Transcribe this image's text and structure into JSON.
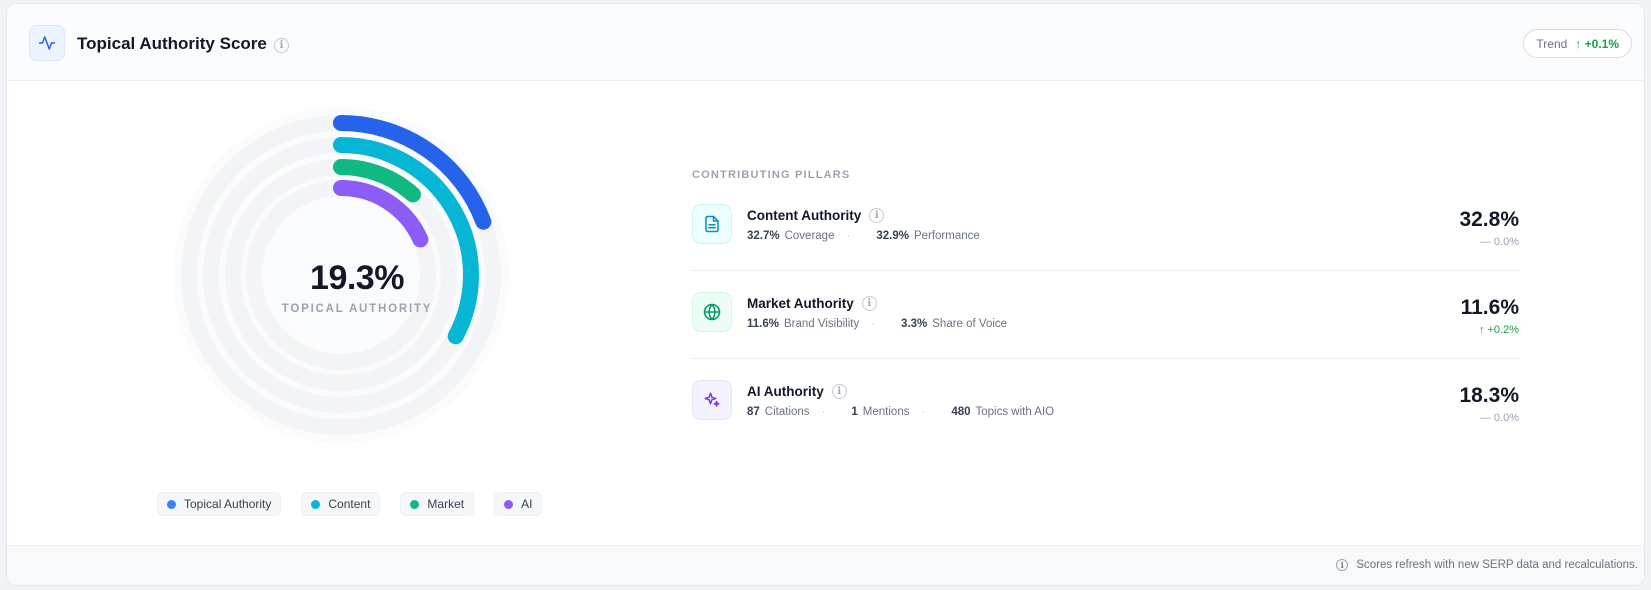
{
  "header": {
    "title": "Topical Authority Score",
    "icon": "activity-icon",
    "trend_label": "Trend",
    "trend_value": "+0.1%",
    "trend_arrow": "↑"
  },
  "chart": {
    "center_value": "19.3%",
    "center_label": "TOPICAL AUTHORITY"
  },
  "chart_data": {
    "type": "radial-bar",
    "series": [
      {
        "name": "Topical Authority",
        "value": 19.3,
        "color": "#2563eb"
      },
      {
        "name": "Content",
        "value": 32.8,
        "color": "#06b6d4"
      },
      {
        "name": "Market",
        "value": 11.6,
        "color": "#10b981"
      },
      {
        "name": "AI",
        "value": 18.3,
        "color": "#8b5cf6"
      }
    ],
    "max": 100
  },
  "legend": [
    {
      "label": "Topical Authority",
      "color": "#3b82f6"
    },
    {
      "label": "Content",
      "color": "#06b6d4"
    },
    {
      "label": "Market",
      "color": "#10b981"
    },
    {
      "label": "AI",
      "color": "#8b5cf6"
    }
  ],
  "pillars": {
    "title": "CONTRIBUTING PILLARS",
    "items": [
      {
        "name": "Content Authority",
        "icon": "document-icon",
        "metrics": [
          {
            "value": "32.7%",
            "label": "Coverage"
          },
          {
            "value": "32.9%",
            "label": "Performance"
          }
        ],
        "value": "32.8%",
        "change": "— 0.0%"
      },
      {
        "name": "Market Authority",
        "icon": "globe-icon",
        "metrics": [
          {
            "value": "11.6%",
            "label": "Brand Visibility"
          },
          {
            "value": "3.3%",
            "label": "Share of Voice"
          }
        ],
        "value": "11.6%",
        "change": "↑ +0.2%"
      },
      {
        "name": "AI Authority",
        "icon": "sparkles-icon",
        "metrics": [
          {
            "value": "87",
            "label": "Citations"
          },
          {
            "value": "1",
            "label": "Mentions"
          },
          {
            "value": "480",
            "label": "Topics with AIO"
          }
        ],
        "value": "18.3%",
        "change": "— 0.0%"
      }
    ]
  },
  "footer": {
    "note": "Scores refresh with new SERP data and recalculations."
  }
}
